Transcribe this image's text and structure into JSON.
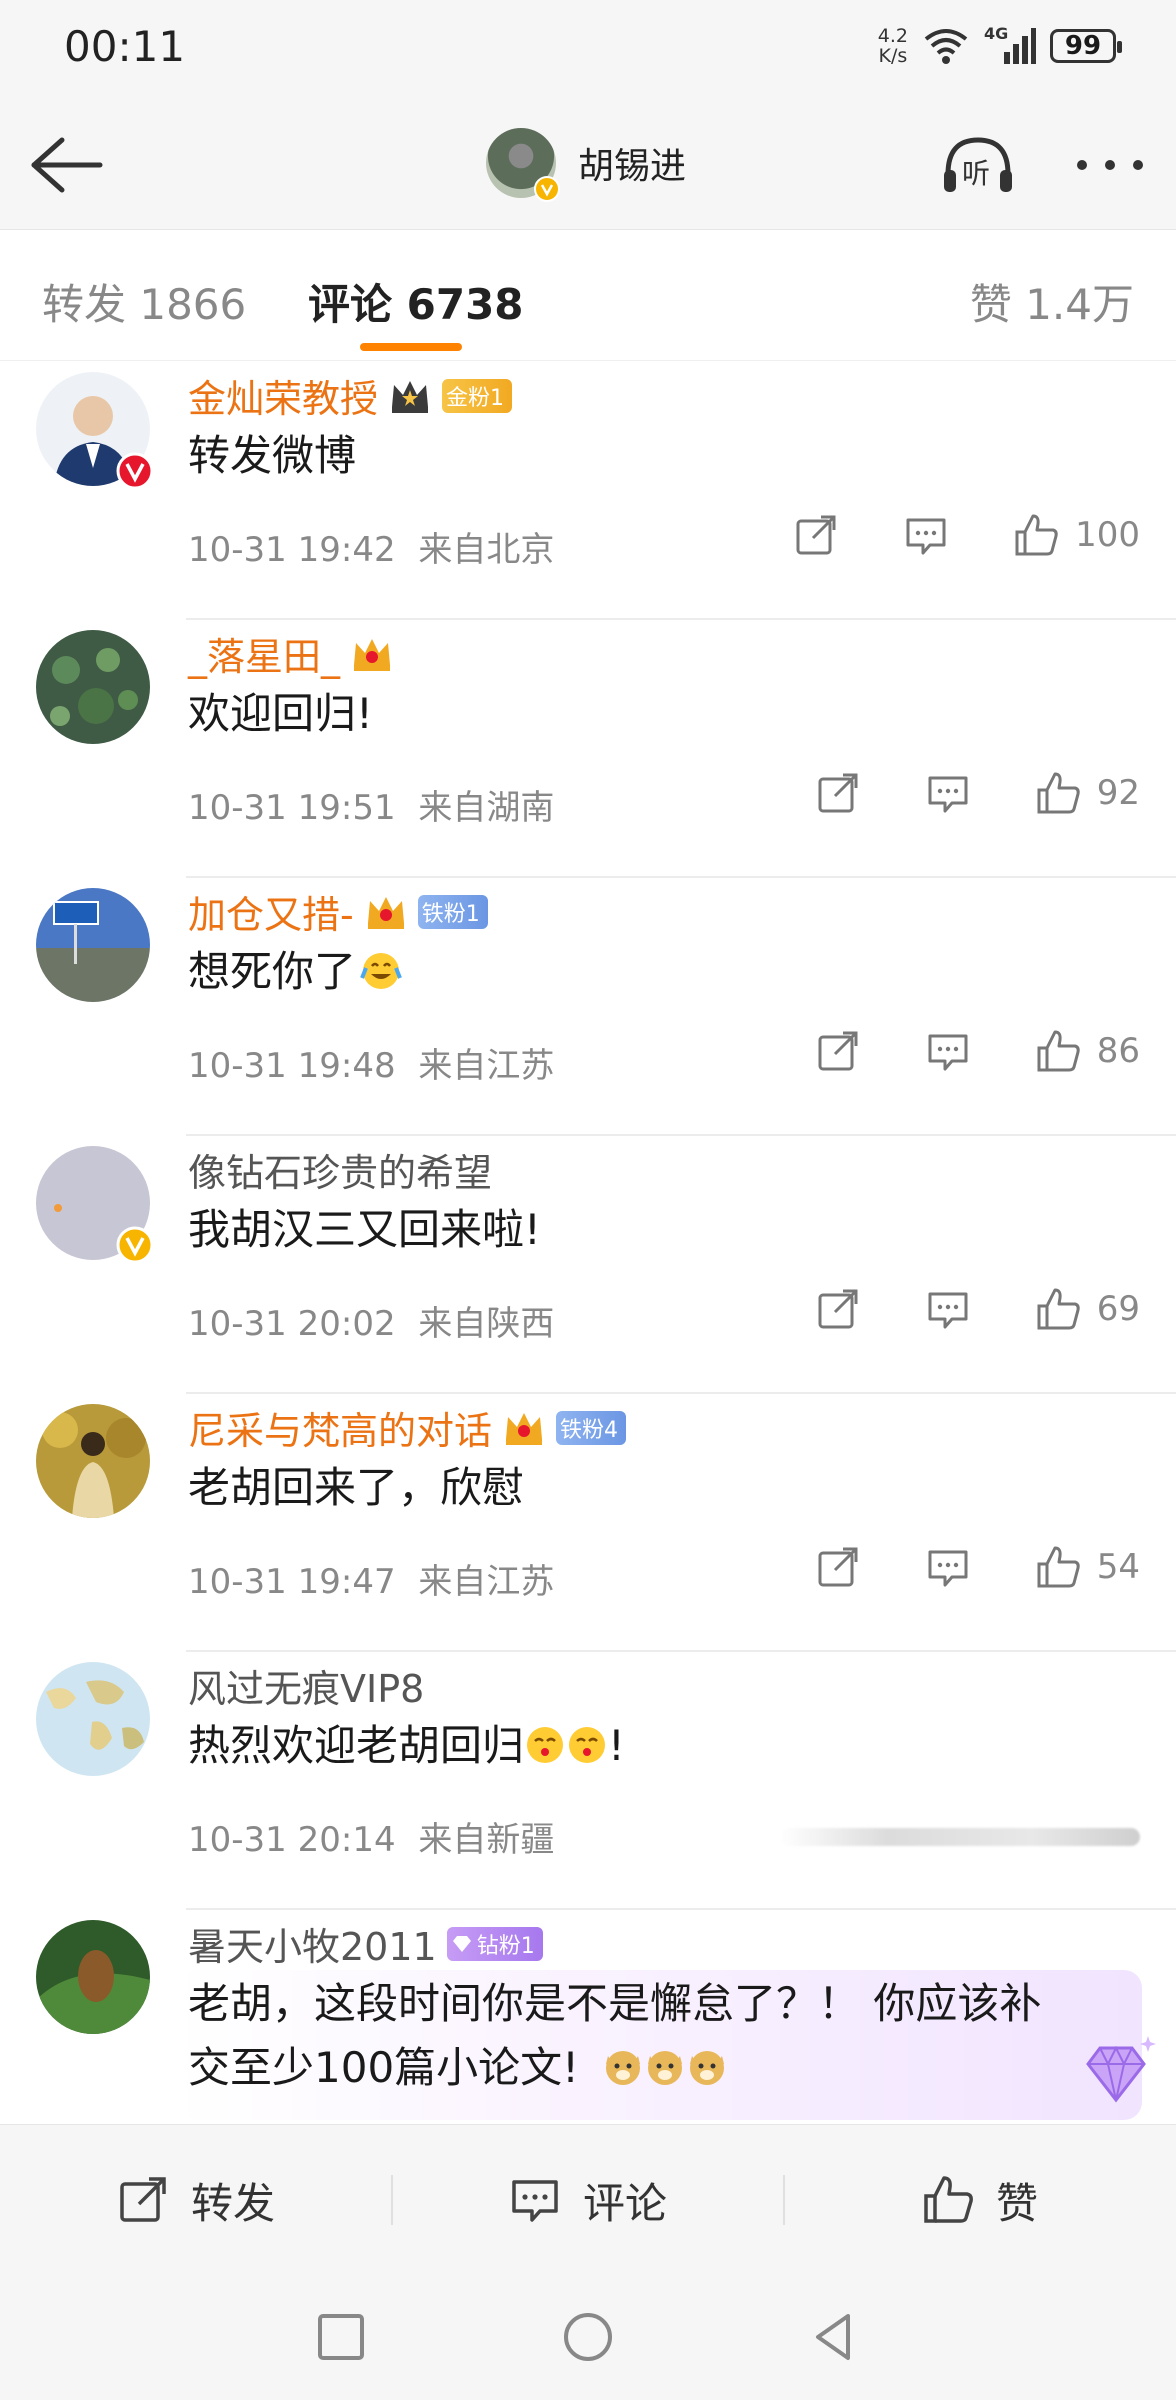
{
  "status_bar": {
    "time": "00:11",
    "net_speed_value": "4.2",
    "net_speed_unit": "K/s",
    "network": "4G",
    "battery": "99"
  },
  "header": {
    "username": "胡锡进",
    "listen_icon_text": "听"
  },
  "tabs": {
    "repost": "转发 1866",
    "comment": "评论 6738",
    "like": "赞 1.4万"
  },
  "comments": [
    {
      "username": "金灿荣教授",
      "badge": "金粉1",
      "text": "转发微博",
      "time": "10-31 19:42",
      "location": "来自北京",
      "likes": "100"
    },
    {
      "username": "_落星田_",
      "text": "欢迎回归!",
      "time": "10-31 19:51",
      "location": "来自湖南",
      "likes": "92"
    },
    {
      "username": "加仓又措-",
      "badge": "铁粉1",
      "text": "想死你了",
      "time": "10-31 19:48",
      "location": "来自江苏",
      "likes": "86"
    },
    {
      "username": "像钻石珍贵的希望",
      "text": "我胡汉三又回来啦!",
      "time": "10-31 20:02",
      "location": "来自陕西",
      "likes": "69"
    },
    {
      "username": "尼采与梵高的对话",
      "badge": "铁粉4",
      "text": "老胡回来了，欣慰",
      "time": "10-31 19:47",
      "location": "来自江苏",
      "likes": "54"
    },
    {
      "username": "风过无痕VIP8",
      "text_before": "热烈欢迎老胡回归",
      "text_after": "!",
      "time": "10-31 20:14",
      "location": "来自新疆"
    },
    {
      "username": "暑天小牧2011",
      "badge": "钻粉1",
      "text_line1": "老胡，这段时间你是不是懈怠了？！ 你应该补",
      "text_line2": "交至少100篇小论文!"
    }
  ],
  "bottom_bar": {
    "repost": "转发",
    "comment": "评论",
    "like": "赞"
  },
  "colors": {
    "accent": "#ff8200",
    "username_orange": "#eb7314",
    "verified_red": "#e6162d",
    "verified_yellow": "#f7b500"
  }
}
